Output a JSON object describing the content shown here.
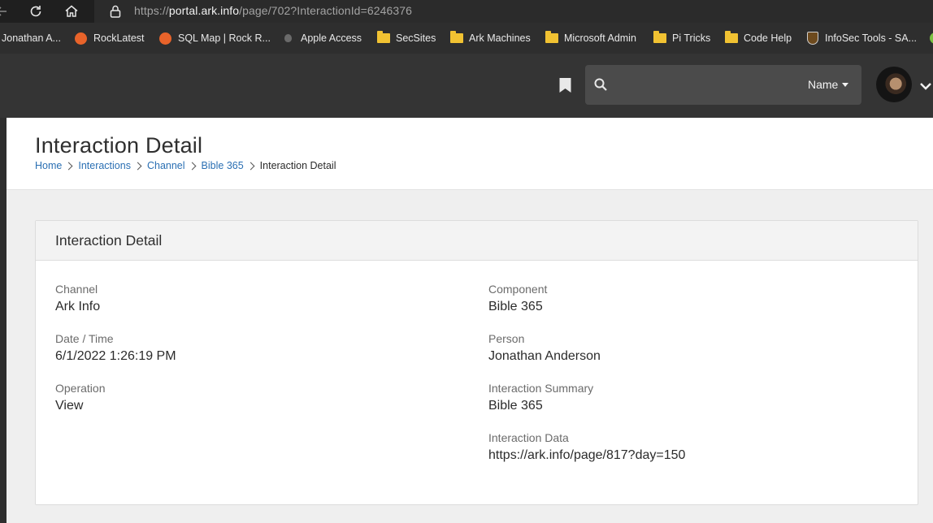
{
  "browser": {
    "url_scheme": "https://",
    "url_host": "portal.ark.info",
    "url_path": "/page/702?InteractionId=6246376"
  },
  "bookmarks": [
    {
      "label": "Jonathan A...",
      "icon": "none"
    },
    {
      "label": "RockLatest",
      "icon": "rock-icon"
    },
    {
      "label": "SQL Map | Rock R...",
      "icon": "rock-icon"
    },
    {
      "label": "Apple Access",
      "icon": "apple-icon"
    },
    {
      "label": "SecSites",
      "icon": "folder-icon"
    },
    {
      "label": "Ark Machines",
      "icon": "folder-icon"
    },
    {
      "label": "Microsoft Admin",
      "icon": "folder-icon"
    },
    {
      "label": "Pi Tricks",
      "icon": "folder-icon"
    },
    {
      "label": "Code Help",
      "icon": "folder-icon"
    },
    {
      "label": "InfoSec Tools - SA...",
      "icon": "shield-icon"
    }
  ],
  "header": {
    "search_value": "",
    "search_type": "Name"
  },
  "page": {
    "title": "Interaction Detail",
    "breadcrumb": [
      "Home",
      "Interactions",
      "Channel",
      "Bible 365",
      "Interaction Detail"
    ]
  },
  "panel": {
    "title": "Interaction Detail",
    "left_fields": [
      {
        "label": "Channel",
        "value": "Ark Info"
      },
      {
        "label": "Date / Time",
        "value": "6/1/2022 1:26:19 PM"
      },
      {
        "label": "Operation",
        "value": "View"
      }
    ],
    "right_fields": [
      {
        "label": "Component",
        "value": "Bible 365"
      },
      {
        "label": "Person",
        "value": "Jonathan Anderson"
      },
      {
        "label": "Interaction Summary",
        "value": "Bible 365"
      },
      {
        "label": "Interaction Data",
        "value": "https://ark.info/page/817?day=150"
      }
    ]
  },
  "colors": {
    "link": "#2a6fb3",
    "header_bg": "#343434",
    "folder": "#f1c232",
    "rock": "#e8632a"
  }
}
